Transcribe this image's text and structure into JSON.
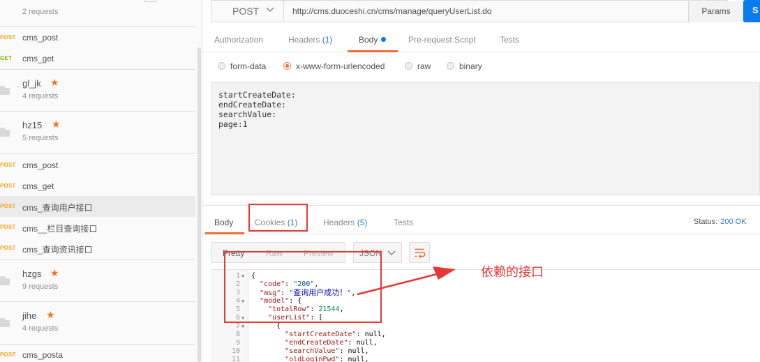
{
  "sidebar": {
    "top_count": "2 requests",
    "entries": [
      {
        "kind": "request",
        "method": "POST",
        "name": "cms_post"
      },
      {
        "kind": "request",
        "method": "GET",
        "name": "cms_get"
      },
      {
        "kind": "collection",
        "name": "gl_jk",
        "count": "4 requests"
      },
      {
        "kind": "collection",
        "name": "hz15",
        "count": "5 requests"
      },
      {
        "kind": "request",
        "method": "POST",
        "name": "cms_post"
      },
      {
        "kind": "request",
        "method": "POST",
        "name": "cms_get"
      },
      {
        "kind": "request",
        "method": "POST",
        "name": "cms_查询用户接口"
      },
      {
        "kind": "request",
        "method": "POST",
        "name": "cms__栏目查询接口"
      },
      {
        "kind": "request",
        "method": "POST",
        "name": "cms_查询资讯接口"
      },
      {
        "kind": "collection",
        "name": "hzgs",
        "count": "9 requests"
      },
      {
        "kind": "collection",
        "name": "jihe",
        "count": "4 requests"
      },
      {
        "kind": "request",
        "method": "POST",
        "name": "cms_posta"
      }
    ]
  },
  "request": {
    "method": "POST",
    "url": "http://cms.duoceshi.cn/cms/manage/queryUserList.do",
    "params_label": "Params",
    "send_label": "S",
    "tabs": {
      "authorization": "Authorization",
      "headers": "Headers",
      "headers_count": "(1)",
      "body": "Body",
      "prerequest": "Pre-request Script",
      "tests": "Tests"
    },
    "body_modes": [
      "form-data",
      "x-www-form-urlencoded",
      "raw",
      "binary"
    ],
    "body_lines": [
      "startCreateDate:",
      "endCreateDate:",
      "searchValue:",
      "page:1"
    ]
  },
  "response": {
    "tabs": {
      "body": "Body",
      "cookies": "Cookies",
      "cookies_count": "(1)",
      "headers": "Headers",
      "headers_count": "(5)",
      "tests": "Tests"
    },
    "status_label": "Status:",
    "status_value": "200 OK",
    "format_tabs": [
      "Pretty",
      "Raw",
      "Preview"
    ],
    "language": "JSON",
    "line_numbers": [
      "1",
      "2",
      "3",
      "4",
      "5",
      "6",
      "7",
      "8",
      "9",
      "10",
      "11"
    ],
    "code": {
      "l2_key": "\"code\"",
      "l2_val": "\"200\"",
      "l3_key": "\"msg\"",
      "l3_val": "查询用户成功！",
      "l4_key": "\"model\"",
      "l5_key": "\"totalRow\"",
      "l5_val": "21544",
      "l6_key": "\"userList\"",
      "l8_key": "\"startCreateDate\"",
      "l8_val": "null",
      "l9_key": "\"endCreateDate\"",
      "l9_val": "null",
      "l10_key": "\"searchValue\"",
      "l10_val": "null",
      "l11_key": "\"oldLoginPwd\"",
      "l11_val": "null"
    }
  },
  "annotation": {
    "text": "依赖的接口",
    "color": "#e53935"
  },
  "colors": {
    "accent": "#f26b3a",
    "send": "#097bed",
    "post": "#f5a623",
    "get": "#7ab800",
    "star": "#f47023",
    "count": "#2a7fc7"
  }
}
